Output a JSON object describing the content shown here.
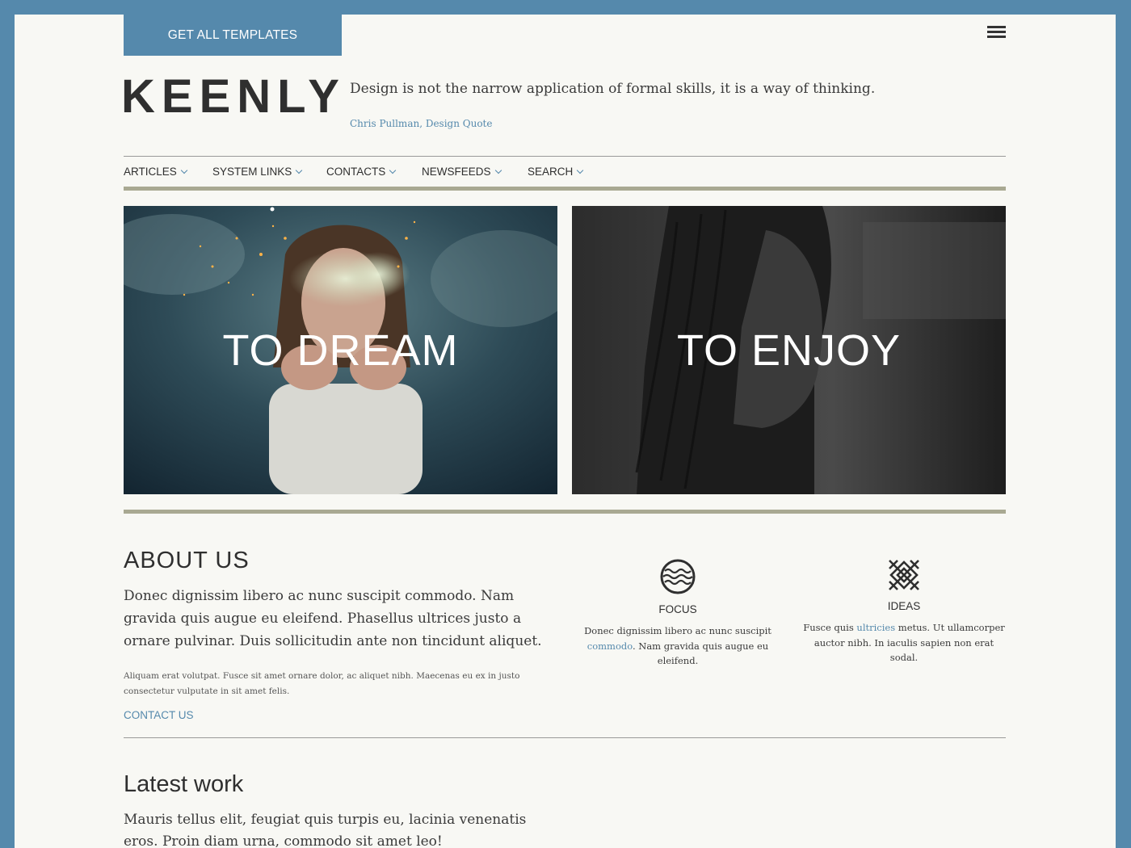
{
  "header": {
    "cta_label": "GET ALL TEMPLATES",
    "logo": "KEENLY",
    "quote": "Design is not the narrow application of formal skills, it is a way of thinking.",
    "quote_author": "Chris Pullman, Design Quote"
  },
  "nav": {
    "items": [
      {
        "label": "ARTICLES"
      },
      {
        "label": "SYSTEM LINKS"
      },
      {
        "label": "CONTACTS"
      },
      {
        "label": "NEWSFEEDS"
      },
      {
        "label": "SEARCH"
      }
    ]
  },
  "heroes": [
    {
      "title": "TO DREAM"
    },
    {
      "title": "TO ENJOY"
    }
  ],
  "about": {
    "heading": "ABOUT US",
    "lead": "Donec dignissim libero ac nunc suscipit commodo. Nam gravida quis augue eu eleifend. Phasellus ultrices justo a ornare pulvinar. Duis sollicitudin ante non tincidunt aliquet.",
    "small": "Aliquam erat volutpat. Fusce sit amet ornare dolor, ac aliquet nibh. Maecenas eu ex in justo consectetur vulputate in sit amet felis.",
    "link": "CONTACT US"
  },
  "features": [
    {
      "icon": "waves-circle-icon",
      "title": "FOCUS",
      "text_before": "Donec dignissim libero ac nunc suscipit ",
      "link": "commodo",
      "text_after": ". Nam gravida quis augue eu eleifend."
    },
    {
      "icon": "lattice-pattern-icon",
      "title": "IDEAS",
      "text_before": "Fusce quis ",
      "link": "ultricies",
      "text_after": " metus. Ut ullamcorper auctor nibh. In iaculis sapien non erat sodal."
    }
  ],
  "latest": {
    "heading": "Latest work",
    "lead": "Mauris tellus elit, feugiat quis turpis eu, lacinia venenatis eros. Proin diam urna, commodo sit amet leo!"
  },
  "colors": {
    "accent": "#5589ac",
    "rule": "#a9a992",
    "background": "#f8f8f4"
  }
}
